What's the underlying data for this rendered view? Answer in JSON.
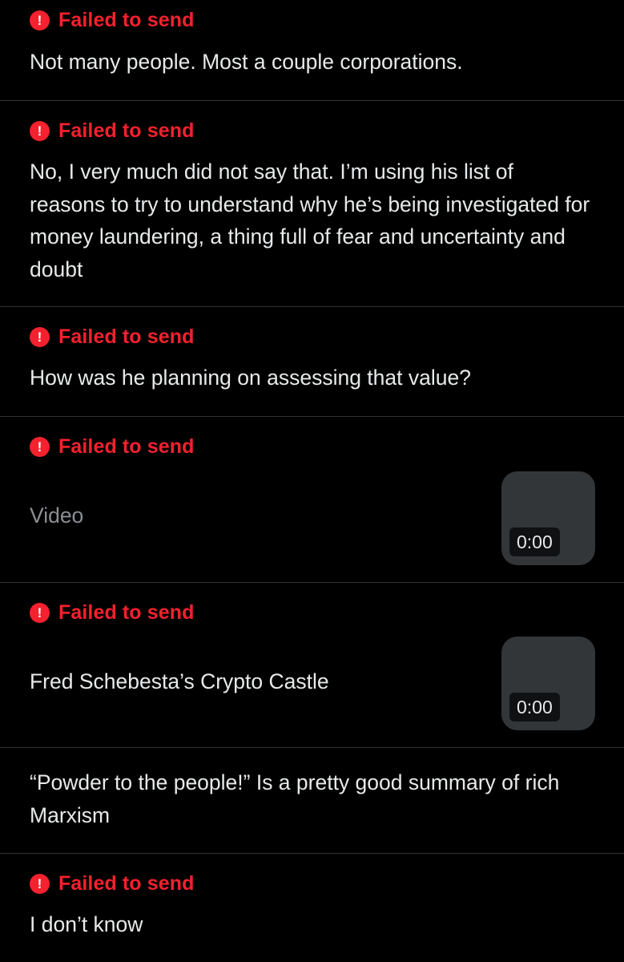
{
  "colors": {
    "background": "#000000",
    "error": "#f4212e",
    "text": "#e7e9ea",
    "muted": "#8b8f93",
    "divider": "#2f3336",
    "thumbnail": "#333639"
  },
  "messages": [
    {
      "status": "Failed to send",
      "status_icon": "exclamation-icon",
      "text": "Not many people. Most a couple corporations."
    },
    {
      "status": "Failed to send",
      "status_icon": "exclamation-icon",
      "text": "No, I very much did not say that. I’m using his list of reasons to try to understand why he’s being investigated for money laundering, a thing full of fear and uncertainty and doubt"
    },
    {
      "status": "Failed to send",
      "status_icon": "exclamation-icon",
      "text": "How was he planning on assessing that value?"
    },
    {
      "status": "Failed to send",
      "status_icon": "exclamation-icon",
      "text": "Video",
      "attachment": {
        "type": "video",
        "duration": "0:00"
      }
    },
    {
      "status": "Failed to send",
      "status_icon": "exclamation-icon",
      "text": "Fred Schebesta’s Crypto Castle",
      "attachment": {
        "type": "video",
        "duration": "0:00"
      }
    },
    {
      "text": "“Powder to the people!” Is a pretty good summary of rich Marxism"
    },
    {
      "status": "Failed to send",
      "status_icon": "exclamation-icon",
      "text": "I don’t know"
    }
  ]
}
